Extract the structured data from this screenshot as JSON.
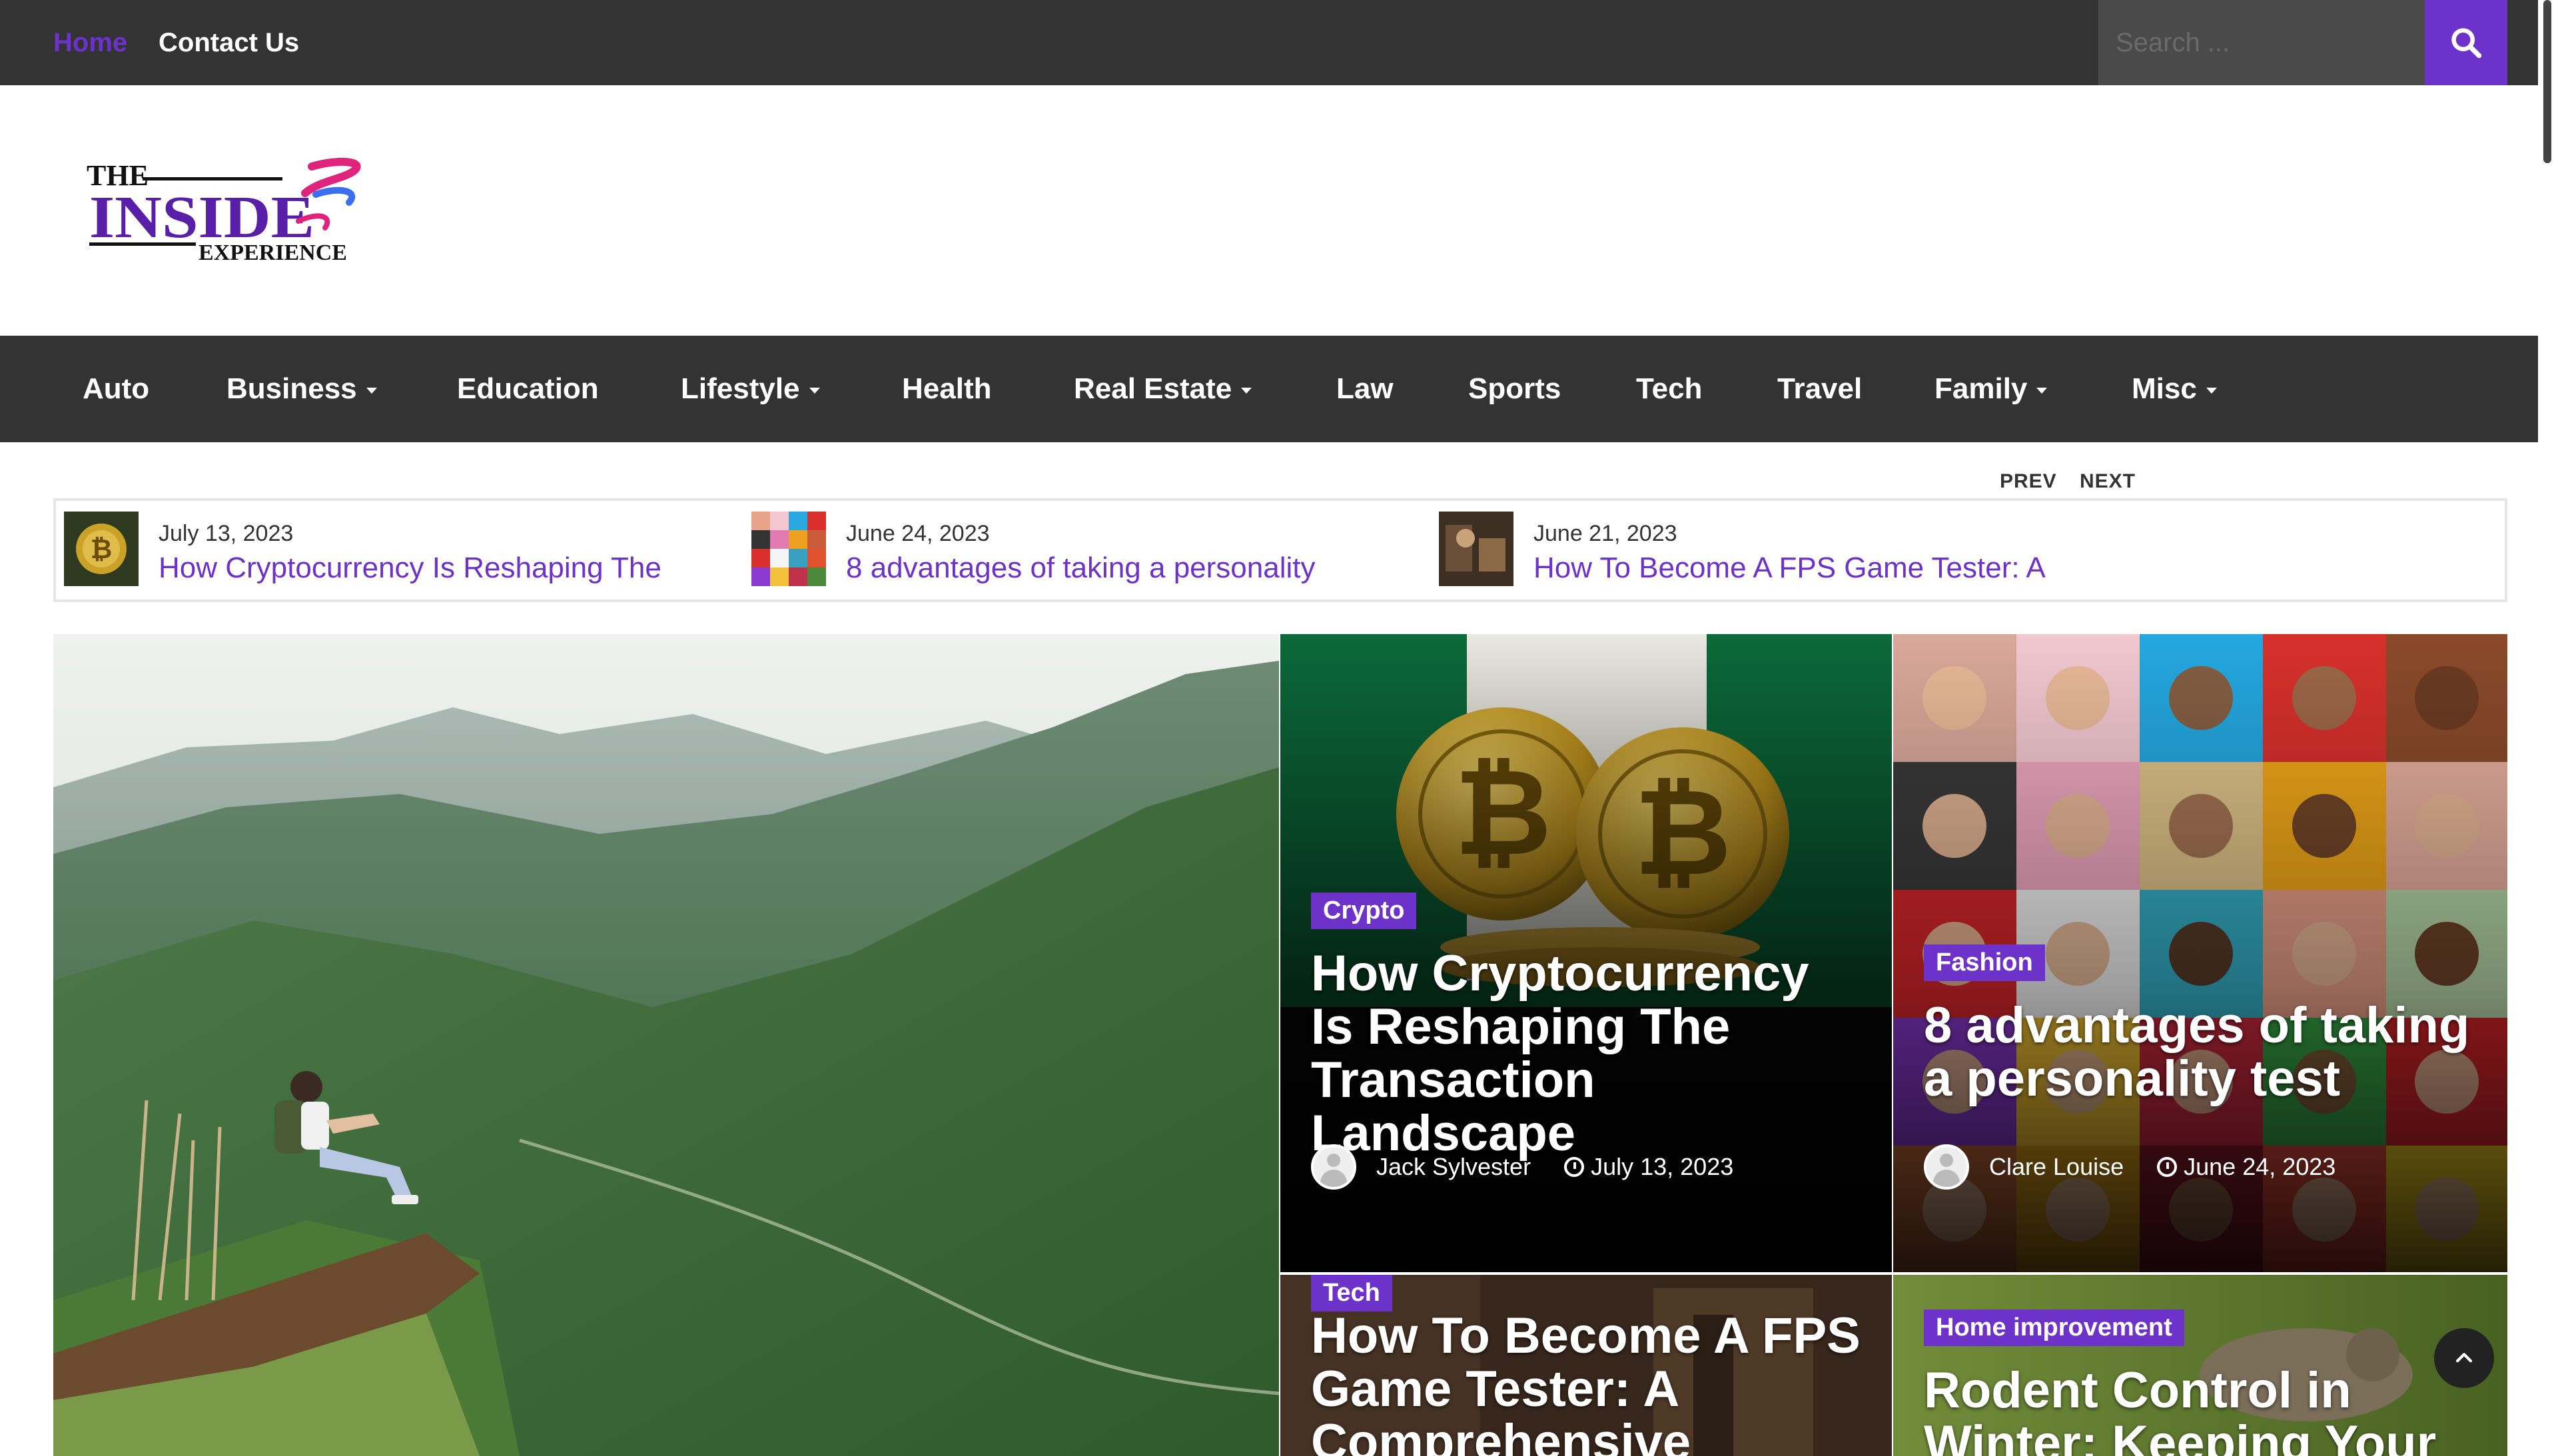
{
  "topbar": {
    "links": [
      "Home",
      "Contact Us"
    ],
    "search_placeholder": "Search ..."
  },
  "logo": {
    "line1": "THE",
    "line2": "INSIDE",
    "line3": "EXPERIENCE"
  },
  "nav": {
    "items": [
      {
        "label": "Auto"
      },
      {
        "label": "Business"
      },
      {
        "label": "Education"
      },
      {
        "label": "Lifestyle"
      },
      {
        "label": "Health"
      },
      {
        "label": "Real Estate"
      },
      {
        "label": "Law"
      },
      {
        "label": "Sports"
      },
      {
        "label": "Tech"
      },
      {
        "label": "Travel"
      },
      {
        "label": "Family"
      },
      {
        "label": "Misc"
      }
    ]
  },
  "ticker": {
    "prev": "PREV",
    "next": "NEXT",
    "items": [
      {
        "date": "July 13, 2023",
        "title": "How Cryptocurrency Is Reshaping The"
      },
      {
        "date": "June 24, 2023",
        "title": "8 advantages of taking a personality"
      },
      {
        "date": "June 21, 2023",
        "title": "How To Become A FPS Game Tester: A"
      }
    ]
  },
  "cards": {
    "crypto": {
      "category": "Crypto",
      "title": "How Cryptocurrency Is Reshaping The Transaction Landscape",
      "author": "Jack Sylvester",
      "date": "July 13, 2023"
    },
    "fashion": {
      "category": "Fashion",
      "title": "8 advantages of taking a personality test",
      "author": "Clare Louise",
      "date": "June 24, 2023"
    },
    "tech": {
      "category": "Tech",
      "title": "How To Become A FPS Game Tester: A Comprehensive"
    },
    "home": {
      "category": "Home improvement",
      "title": "Rodent Control in Winter: Keeping Your"
    }
  },
  "colors": {
    "accent": "#6d32c9",
    "bar": "#333333"
  }
}
